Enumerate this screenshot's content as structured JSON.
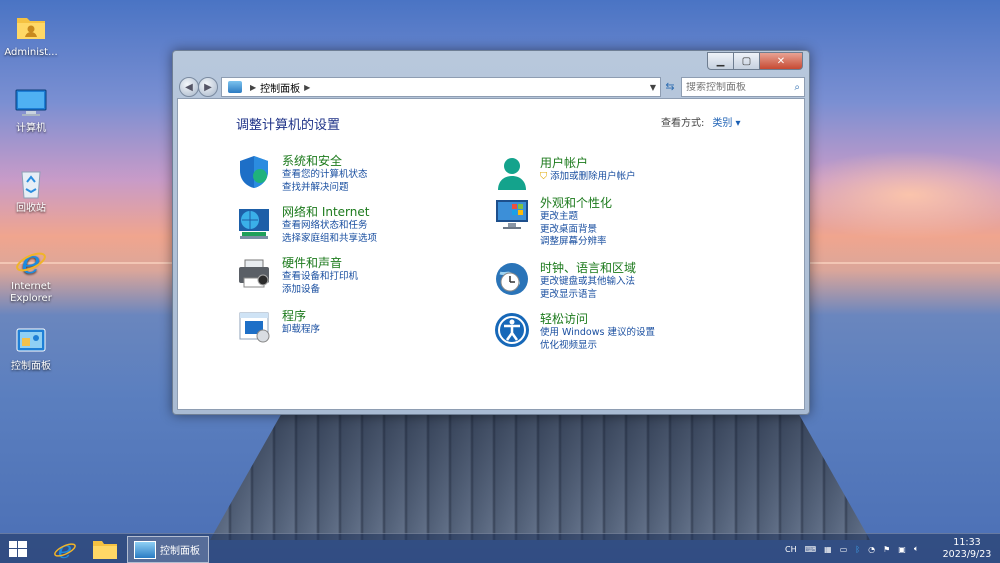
{
  "desktop": {
    "icons": [
      {
        "label": "Administ...",
        "icon": "folder-icon"
      },
      {
        "label": "计算机",
        "icon": "computer-icon"
      },
      {
        "label": "回收站",
        "icon": "recycle-bin-icon"
      },
      {
        "label": "Internet Explorer",
        "icon": "internet-explorer-icon"
      },
      {
        "label": "控制面板",
        "icon": "control-panel-icon"
      }
    ]
  },
  "window": {
    "address": {
      "segment": "控制面板"
    },
    "search": {
      "placeholder": "搜索控制面板"
    },
    "title": "调整计算机的设置",
    "view_by": {
      "label": "查看方式:",
      "value": "类别"
    },
    "categories_left": [
      {
        "icon": "security-shield-icon",
        "title": "系统和安全",
        "links": [
          "查看您的计算机状态",
          "查找并解决问题"
        ]
      },
      {
        "icon": "network-globe-icon",
        "title": "网络和 Internet",
        "links": [
          "查看网络状态和任务",
          "选择家庭组和共享选项"
        ]
      },
      {
        "icon": "printer-icon",
        "title": "硬件和声音",
        "links": [
          "查看设备和打印机",
          "添加设备"
        ]
      },
      {
        "icon": "programs-icon",
        "title": "程序",
        "links": [
          "卸载程序"
        ]
      }
    ],
    "categories_right": [
      {
        "icon": "user-accounts-icon",
        "title": "用户帐户",
        "links": [
          "添加或删除用户帐户"
        ]
      },
      {
        "icon": "display-personalization-icon",
        "title": "外观和个性化",
        "links": [
          "更改主题",
          "更改桌面背景",
          "调整屏幕分辨率"
        ]
      },
      {
        "icon": "clock-globe-icon",
        "title": "时钟、语言和区域",
        "links": [
          "更改键盘或其他输入法",
          "更改显示语言"
        ]
      },
      {
        "icon": "accessibility-icon",
        "title": "轻松访问",
        "links": [
          "使用 Windows 建议的设置",
          "优化视频显示"
        ]
      }
    ]
  },
  "taskbar": {
    "active_item": "控制面板",
    "lang": "CH",
    "time": "11:33",
    "date": "2023/9/23"
  }
}
